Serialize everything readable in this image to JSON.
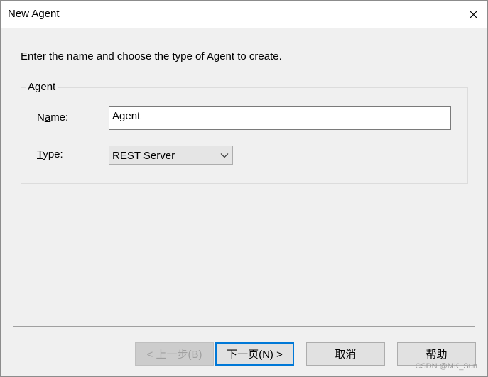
{
  "window": {
    "title": "New Agent"
  },
  "prompt": "Enter the name and choose the type of Agent to create.",
  "group": {
    "label": "Agent",
    "name_label_prefix": "N",
    "name_label_mnemonic": "a",
    "name_label_suffix": "me:",
    "name_value": "Agent",
    "type_label_mnemonic": "T",
    "type_label_suffix": "ype:",
    "type_value": "REST Server"
  },
  "buttons": {
    "back": "< 上一步(B)",
    "next": "下一页(N) >",
    "cancel": "取消",
    "help": "帮助"
  },
  "watermark": "CSDN @MK_Sun",
  "icons": {
    "close": "close-icon",
    "dropdown": "chevron-down-icon"
  }
}
